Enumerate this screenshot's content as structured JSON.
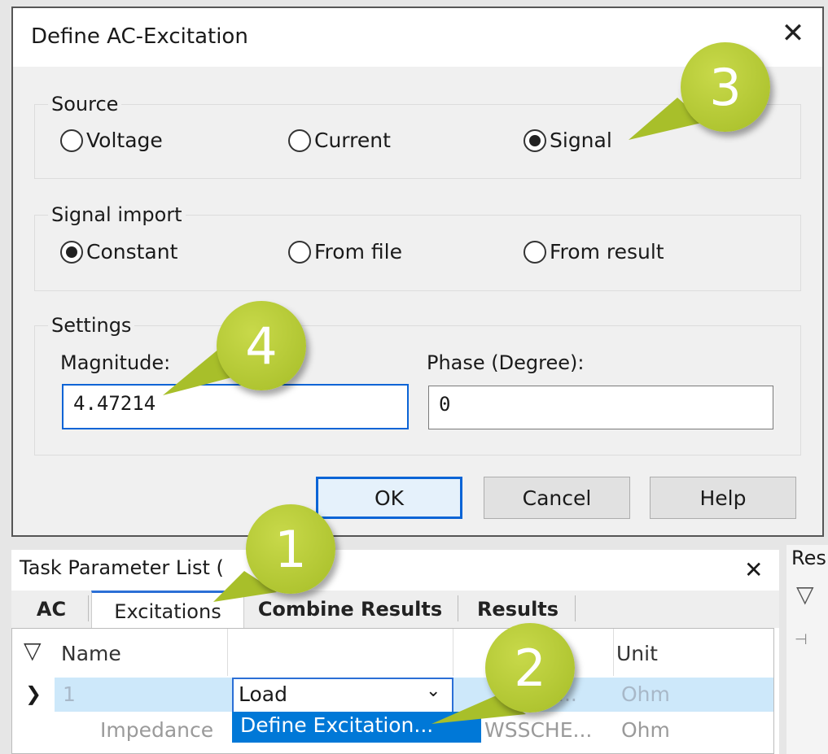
{
  "dialog": {
    "title": "Define AC-Excitation",
    "close_icon": "close-icon",
    "source": {
      "legend": "Source",
      "options": [
        "Voltage",
        "Current",
        "Signal"
      ],
      "selected": "Signal"
    },
    "signal_import": {
      "legend": "Signal import",
      "options": [
        "Constant",
        "From file",
        "From result"
      ],
      "selected": "Constant"
    },
    "settings": {
      "legend": "Settings",
      "magnitude_label": "Magnitude:",
      "magnitude_value": "4.47214",
      "phase_label": "Phase (Degree):",
      "phase_value": "0"
    },
    "buttons": {
      "ok": "OK",
      "cancel": "Cancel",
      "help": "Help"
    }
  },
  "panel": {
    "title": "Task Parameter List (",
    "close_icon": "close-icon",
    "tabs": [
      "AC",
      "Excitations",
      "Combine Results",
      "Results"
    ],
    "active_tab": "Excitations",
    "grid": {
      "headers": {
        "name": "Name",
        "unit": "Unit"
      },
      "row1": {
        "index": "1",
        "value": "Load",
        "ghost": "...",
        "unit": "Ohm"
      },
      "row2": {
        "name": "Impedance",
        "value_fragment": "WSSCHE...",
        "unit": "Ohm"
      },
      "dropdown_item": "Define Excitation..."
    }
  },
  "right_panel": {
    "title": "Res"
  },
  "callouts": [
    "1",
    "2",
    "3",
    "4"
  ],
  "colors": {
    "accent": "#0078d7",
    "callout": "#b2c630"
  }
}
